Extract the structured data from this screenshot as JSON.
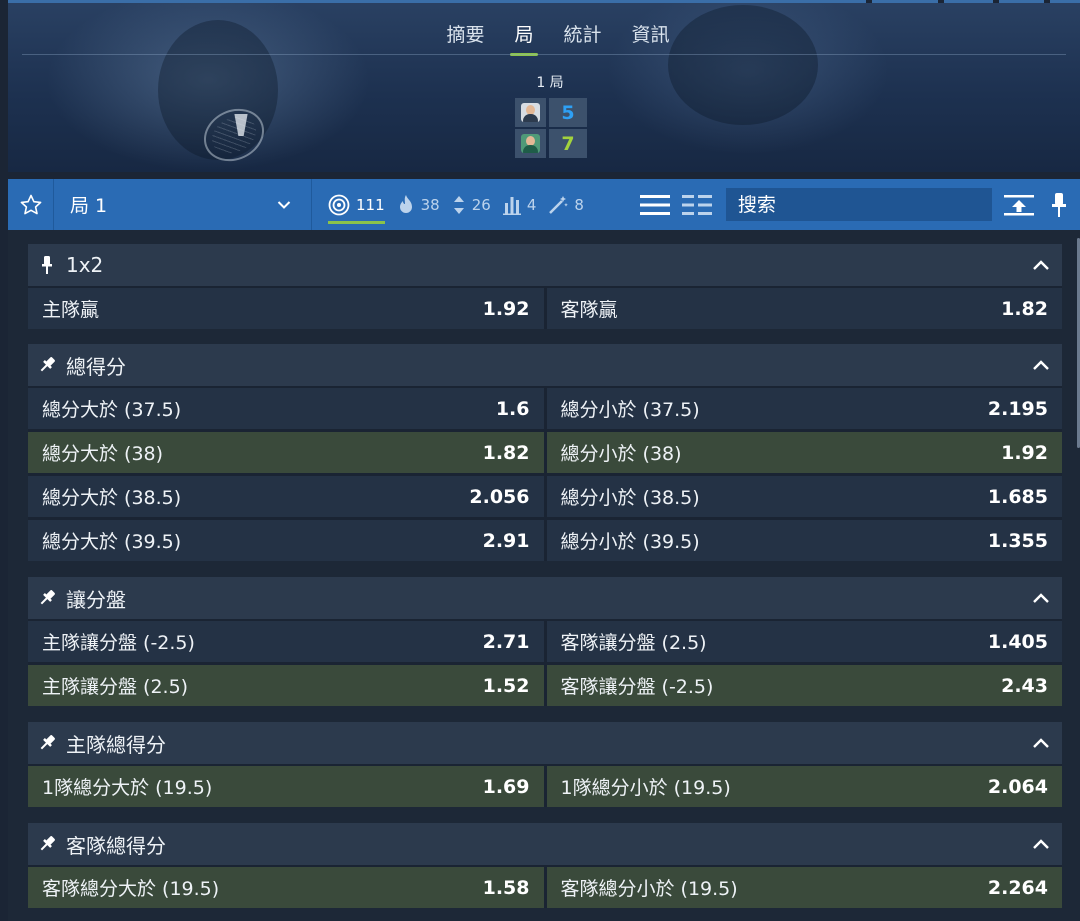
{
  "header": {
    "tabs": [
      {
        "label": "摘要",
        "active": false
      },
      {
        "label": "局",
        "active": true
      },
      {
        "label": "統計",
        "active": false
      },
      {
        "label": "資訊",
        "active": false
      }
    ],
    "period_label": "1 局",
    "scores": [
      {
        "player": "home",
        "value": "5",
        "color": "#2ea0f5"
      },
      {
        "player": "away",
        "value": "7",
        "color": "#a3d33d"
      }
    ]
  },
  "toolbar": {
    "star_icon": "star-icon",
    "select_label": "局 1",
    "filters": [
      {
        "icon": "target-icon",
        "count": "111",
        "active": true
      },
      {
        "icon": "flame-icon",
        "count": "38",
        "active": false
      },
      {
        "icon": "updown-icon",
        "count": "26",
        "active": false
      },
      {
        "icon": "bars-icon",
        "count": "4",
        "active": false
      },
      {
        "icon": "wand-icon",
        "count": "8",
        "active": false
      }
    ],
    "search_placeholder": "搜索"
  },
  "markets": [
    {
      "title": "1x2",
      "rows": [
        [
          {
            "label": "主隊贏",
            "odd": "1.92",
            "hl": false
          },
          {
            "label": "客隊贏",
            "odd": "1.82",
            "hl": false
          }
        ]
      ]
    },
    {
      "title": "總得分",
      "rows": [
        [
          {
            "label": "總分大於 (37.5)",
            "odd": "1.6",
            "hl": false
          },
          {
            "label": "總分小於 (37.5)",
            "odd": "2.195",
            "hl": false
          }
        ],
        [
          {
            "label": "總分大於 (38)",
            "odd": "1.82",
            "hl": true
          },
          {
            "label": "總分小於 (38)",
            "odd": "1.92",
            "hl": true
          }
        ],
        [
          {
            "label": "總分大於 (38.5)",
            "odd": "2.056",
            "hl": false
          },
          {
            "label": "總分小於 (38.5)",
            "odd": "1.685",
            "hl": false
          }
        ],
        [
          {
            "label": "總分大於 (39.5)",
            "odd": "2.91",
            "hl": false
          },
          {
            "label": "總分小於 (39.5)",
            "odd": "1.355",
            "hl": false
          }
        ]
      ]
    },
    {
      "title": "讓分盤",
      "rows": [
        [
          {
            "label": "主隊讓分盤 (-2.5)",
            "odd": "2.71",
            "hl": false
          },
          {
            "label": "客隊讓分盤 (2.5)",
            "odd": "1.405",
            "hl": false
          }
        ],
        [
          {
            "label": "主隊讓分盤 (2.5)",
            "odd": "1.52",
            "hl": true
          },
          {
            "label": "客隊讓分盤 (-2.5)",
            "odd": "2.43",
            "hl": true
          }
        ]
      ]
    },
    {
      "title": "主隊總得分",
      "rows": [
        [
          {
            "label": "1隊總分大於 (19.5)",
            "odd": "1.69",
            "hl": true
          },
          {
            "label": "1隊總分小於 (19.5)",
            "odd": "2.064",
            "hl": true
          }
        ]
      ]
    },
    {
      "title": "客隊總得分",
      "rows": [
        [
          {
            "label": "客隊總分大於 (19.5)",
            "odd": "1.58",
            "hl": true
          },
          {
            "label": "客隊總分小於 (19.5)",
            "odd": "2.264",
            "hl": true
          }
        ]
      ]
    }
  ]
}
